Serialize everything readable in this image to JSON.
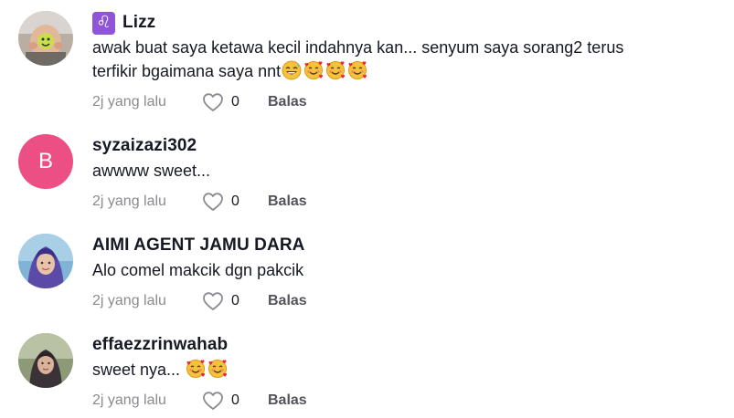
{
  "comments": [
    {
      "username": "Lizz",
      "zodiac_symbol": "♌",
      "zodiac_icon": "leo-zodiac-icon",
      "text_line1": "awak buat saya ketawa kecil indahnya kan... senyum saya sorang2 terus",
      "text_line2": "terfikir bgaimana saya nnt",
      "emojis": [
        "grinning-sweat-emoji",
        "smiling-hearts-emoji",
        "smiling-hearts-emoji",
        "smiling-hearts-emoji"
      ],
      "time": "2j yang lalu",
      "likes": "0",
      "reply_label": "Balas"
    },
    {
      "username": "syzaizazi302",
      "avatar_letter": "B",
      "avatar_color": "#ec4f83",
      "text_line1": "awwww sweet...",
      "time": "2j yang lalu",
      "likes": "0",
      "reply_label": "Balas"
    },
    {
      "username": "AIMI AGENT JAMU DARA",
      "text_line1": "Alo comel makcik dgn pakcik",
      "time": "2j yang lalu",
      "likes": "0",
      "reply_label": "Balas"
    },
    {
      "username": "effaezzrinwahab",
      "text_line1": "sweet nya...",
      "emojis": [
        "smiling-hearts-emoji",
        "smiling-hearts-emoji"
      ],
      "time": "2j yang lalu",
      "likes": "0",
      "reply_label": "Balas"
    }
  ],
  "colors": {
    "text": "#161823",
    "muted": "#8a8b91",
    "reply": "#53535c",
    "zodiac_bg": "#8f55d6"
  }
}
